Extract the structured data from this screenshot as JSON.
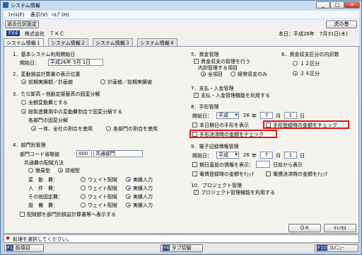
{
  "window": {
    "title": "システム情報",
    "controls": [
      "_",
      "□",
      "✕"
    ]
  },
  "menu": [
    "ﾌｧｲﾙ(F)",
    "表示(V)",
    "ﾍﾙﾌﾟ(H)"
  ],
  "toolbar": {
    "past_button": "過去仕訳設定",
    "right_button": "虎の巻"
  },
  "info": {
    "key": "FX4",
    "company": "株式会社　ＴＫＣ",
    "date": "本日：平成26年　7月31日(木)"
  },
  "tabs": [
    "システム情報１",
    "システム情報２",
    "システム情報３",
    "システム情報４"
  ],
  "sec1": {
    "title": "1．基本システム利用開始日",
    "start_label": "開始日：",
    "start_value": "平成26年 5月 1日"
  },
  "sec2": {
    "title": "2．変動損益計算書の表示位置",
    "opt1": "前期実績額／計画値",
    "opt2": "計画値／前期実績値"
  },
  "sec3": {
    "title": "3．たな卸高・他勘定振替高の固変分解",
    "opt1": "全額変動費とする",
    "opt2": "総製造費用中の変動費割合で固変分解する",
    "sub_label": "各部門の固変分解",
    "sub1": "一体、全社の割合を使用",
    "sub2": "各部門の割合を使用"
  },
  "sec4": {
    "title": "4．部門別管理",
    "code_label": "部門コード省略値",
    "code_value": "000",
    "code_name": "共通部門",
    "method_label": "共通費の配賦方法",
    "m1": "簡易型",
    "m2": "詳細型",
    "rows": [
      {
        "name": "変　動　費：",
        "a": "ウェイト配賦",
        "b": "実績入力"
      },
      {
        "name": "人　件　費：",
        "a": "ウェイト配賦",
        "b": "実績入力"
      },
      {
        "name": "その他固定費：",
        "a": "ウェイト配賦",
        "b": "実績入力"
      },
      {
        "name": "設　備　費：",
        "a": "ウェイト配賦",
        "b": "実績入力"
      }
    ],
    "footer_check": "配賦額を部門別損益計算書等へ表示する"
  },
  "sec5": {
    "title": "5．資金管理",
    "check": "資金収支の管理を行う",
    "items_label": "内訳管理する項目",
    "r1": "全項目",
    "r2": "経常収支のみ"
  },
  "sec6": {
    "title": "6．資金収支区分の内訳数",
    "r1": "１２区分",
    "r2": "２４区分"
  },
  "sec7": {
    "title": "7．支払・入金管理",
    "check": "支払・入金管理機能を利用する"
  },
  "sec8": {
    "title": "8．手形管理",
    "start_label": "開始日：",
    "era": "平成",
    "y": "26",
    "y_unit": "年",
    "m": "7",
    "m_unit": "月",
    "d": "1",
    "d_unit": "日",
    "check1": "本日期日の手形を表示",
    "check2": "手形登録時の金額をチェック",
    "check3": "手形決済時の金額をチェック"
  },
  "sec9": {
    "title": "9．電子記録債権管理",
    "start_label": "開始日：",
    "era": "平成",
    "y": "26",
    "y_unit": "年",
    "m": "7",
    "m_unit": "月",
    "d": "1",
    "d_unit": "日",
    "check1": "期日直前の債権を表示：",
    "days_label": "日前から表示",
    "check2": "電債登録時の金額をﾁｪｯｸ",
    "check3": "電債決済時の金額をﾁｪｯｸ"
  },
  "sec10": {
    "title": "10．プロジェクト管理",
    "check": "プロジェクト管理機能を利用する"
  },
  "buttons": {
    "ok": "ＯＫ",
    "cancel": "ｷｬﾝｾﾙ"
  },
  "status": "処理を選択してください。",
  "fkeys": {
    "f1_key": "F1",
    "f1": "前項目",
    "f6_key": "F6",
    "f6": "タブ切替",
    "f10_key": "F10",
    "f10": "ﾌﾙﾒﾆｭｰ"
  },
  "colors": {
    "highlight": "#e01818",
    "accent": "#143c96"
  }
}
